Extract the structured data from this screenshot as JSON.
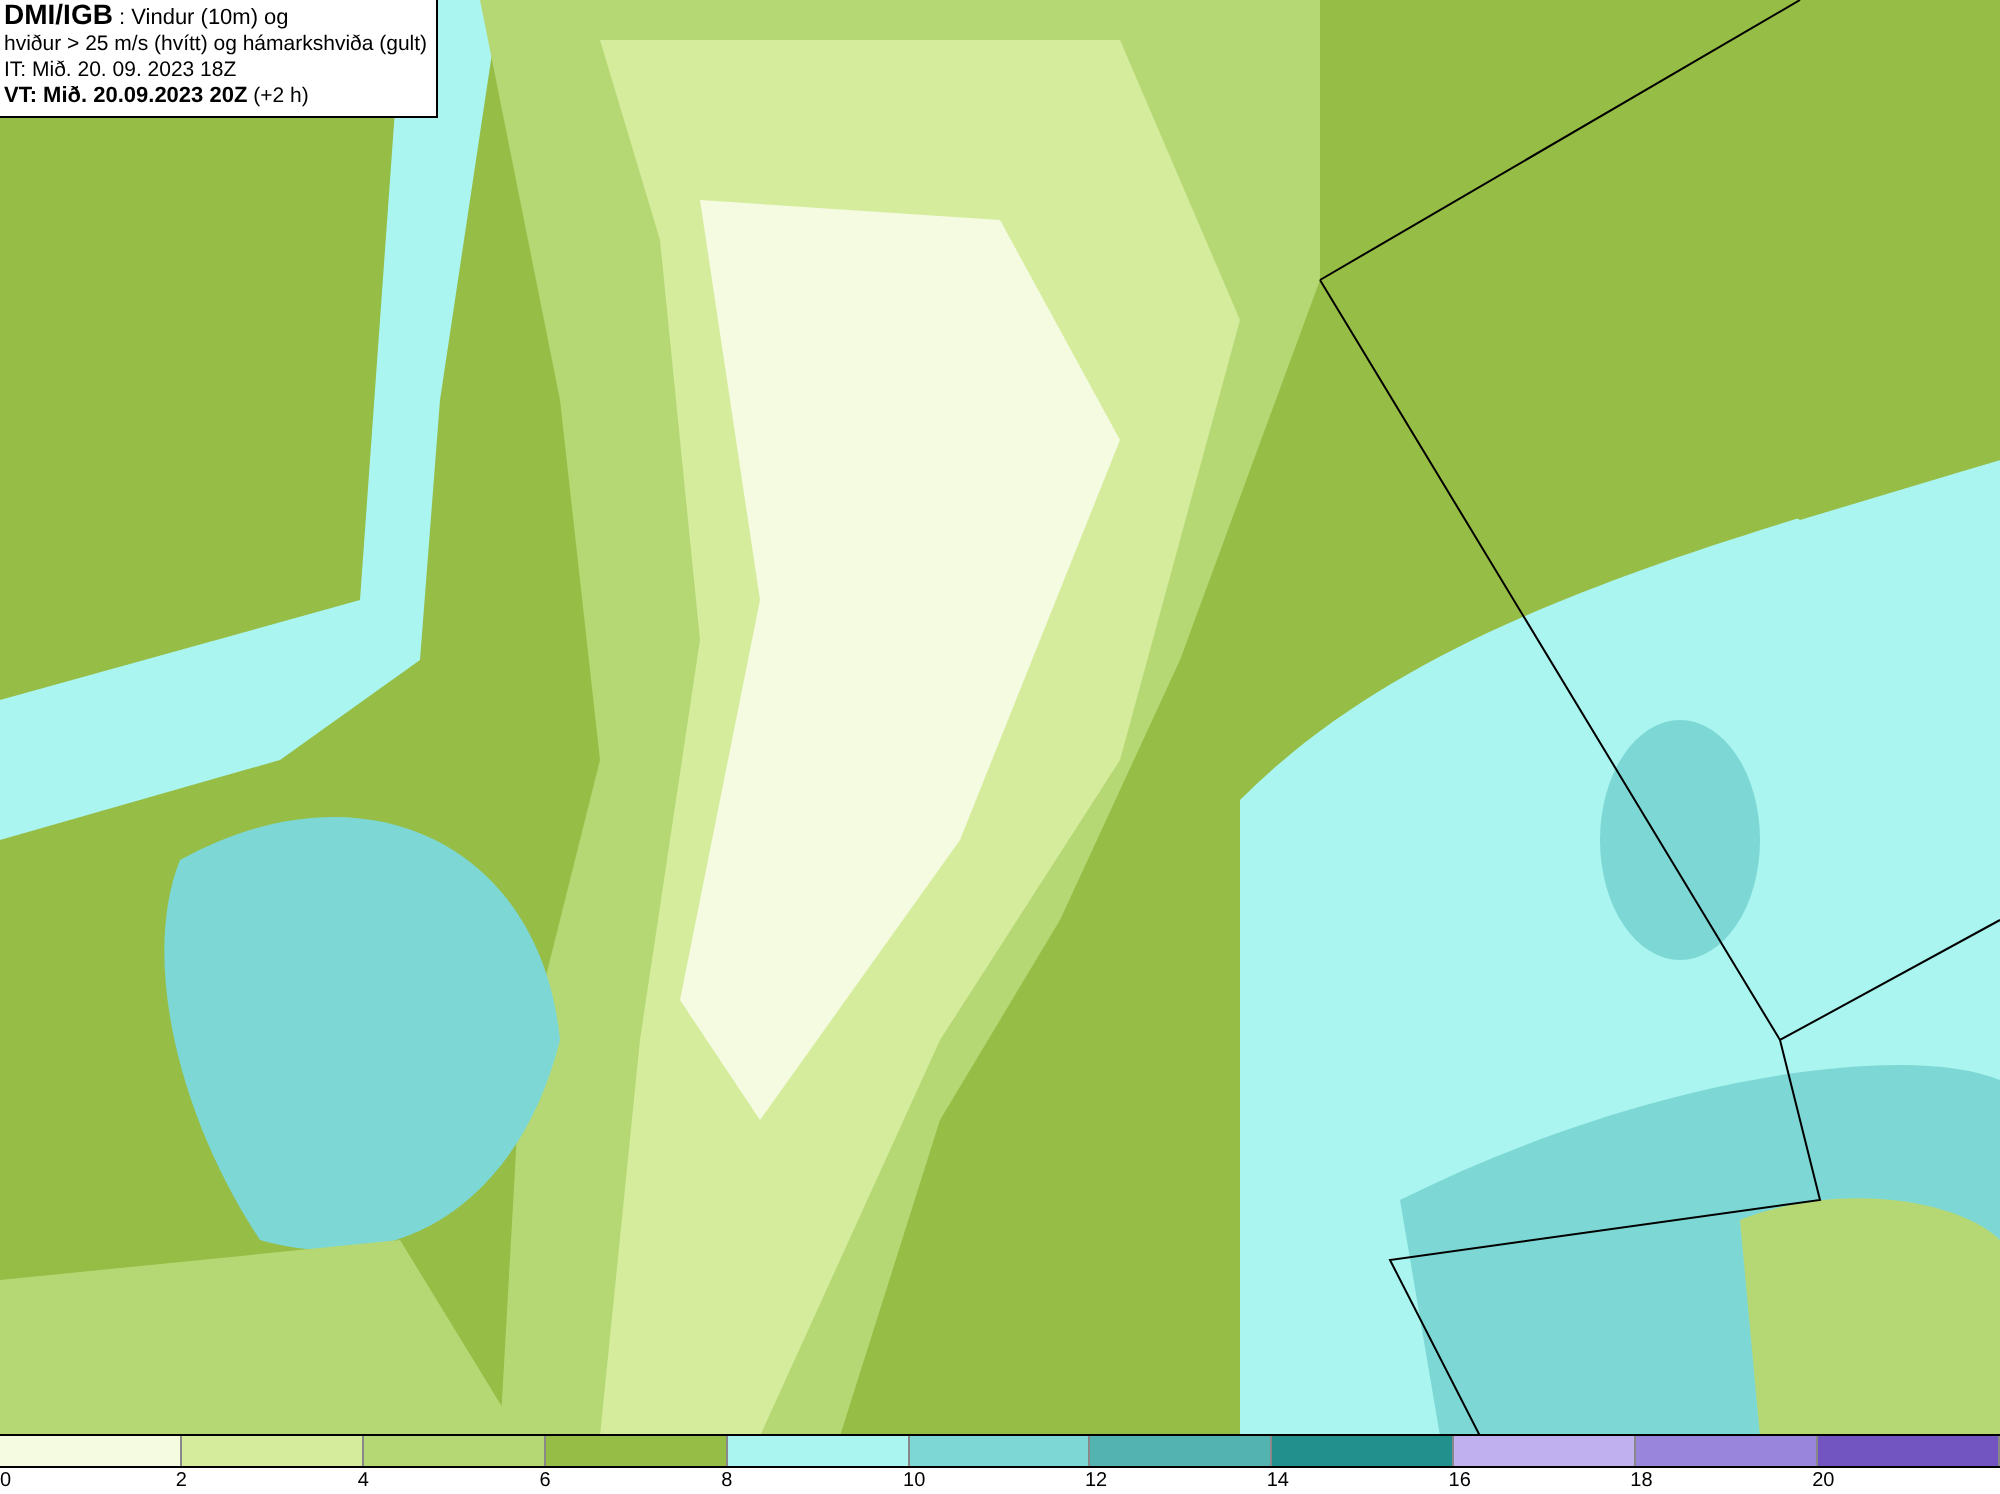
{
  "map": {
    "title_lines": [
      "**DMI/IGB** : Vindur (10m) og",
      "hviður > 25 m/s (hvítt) og hámarkshviða (gult)",
      "IT: Mið. 20. 09. 2023 18Z",
      "**VT: Mið. 20.09.2023 20Z** (+2 h)"
    ]
  },
  "legend": {
    "bins": [
      {
        "color": "#f5fbe0"
      },
      {
        "color": "#d5ec9c"
      },
      {
        "color": "#b5d875"
      },
      {
        "color": "#96bd45"
      },
      {
        "color": "#aaf5f0"
      },
      {
        "color": "#7dd8d5"
      },
      {
        "color": "#52b3b0"
      },
      {
        "color": "#22908c"
      },
      {
        "color": "#c0b0f0"
      },
      {
        "color": "#9a85dc"
      },
      {
        "color": "#7255c0"
      }
    ],
    "ticks": [
      "0",
      "2",
      "4",
      "6",
      "8",
      "10",
      "12",
      "14",
      "16",
      "18",
      "20"
    ]
  }
}
